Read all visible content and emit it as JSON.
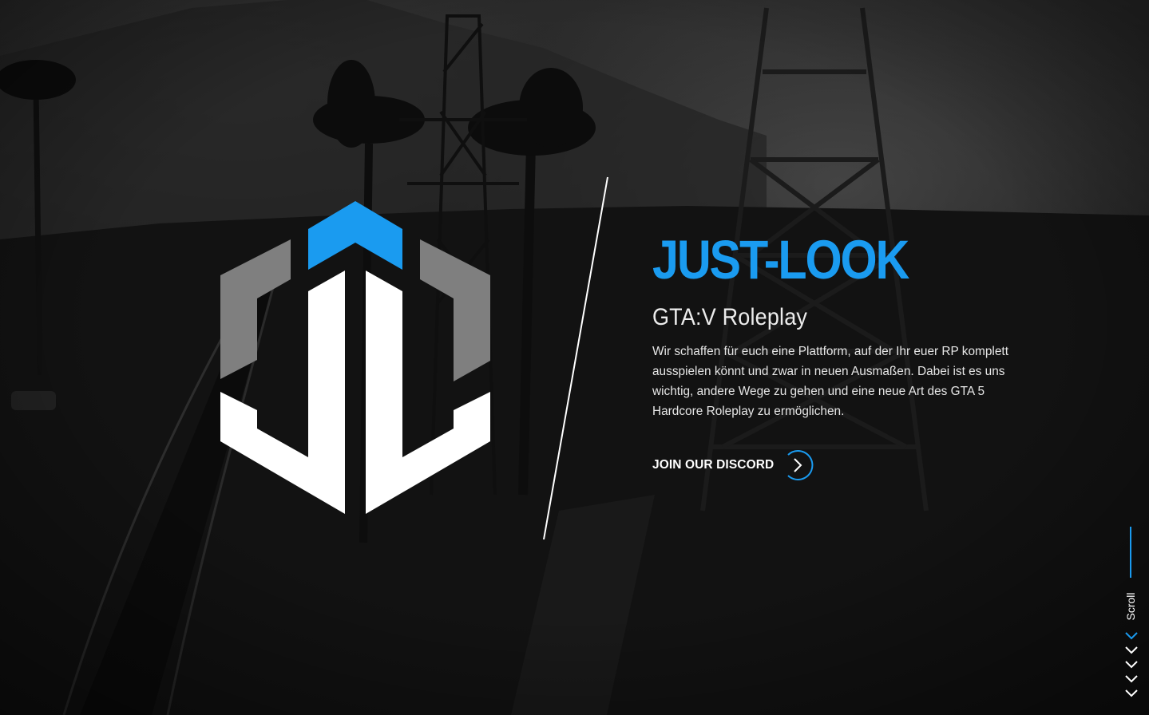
{
  "brand": {
    "title": "JUST-LOOK",
    "subtitle": "GTA:V Roleplay",
    "description": "Wir schaffen für euch eine Plattform, auf der Ihr euer RP komplett ausspielen könnt und zwar in neuen Ausmaßen. Dabei ist es uns wichtig, andere Wege zu gehen und eine neue Art des GTA 5 Hardcore Roleplay zu ermöglichen.",
    "logo_icon": "just-look-hexagon-logo"
  },
  "cta": {
    "label": "JOIN OUR DISCORD",
    "icon": "chevron-right-icon"
  },
  "scroll": {
    "label": "Scroll",
    "icon": "chevron-down-icon"
  },
  "colors": {
    "accent": "#1a9bf0",
    "logo_grey": "#7f7f7f",
    "logo_white": "#ffffff",
    "text": "#e6e6e6",
    "background": "#161616"
  }
}
